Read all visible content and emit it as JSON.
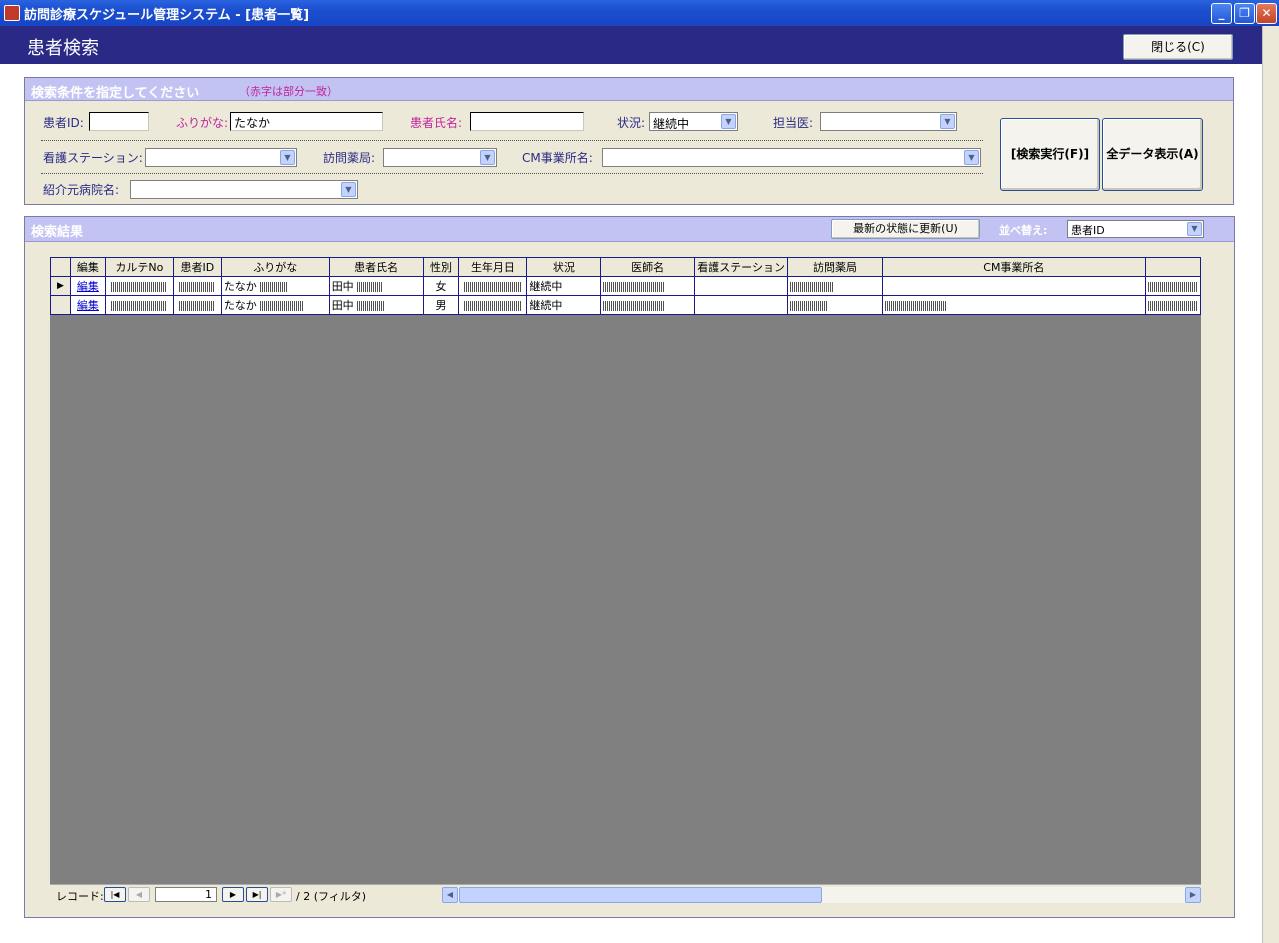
{
  "window": {
    "title": "訪問診療スケジュール管理システム - [患者一覧]",
    "minimize": "_",
    "restore": "❐",
    "close": "✕"
  },
  "header": {
    "title": "患者検索",
    "close_button": "閉じる(C)"
  },
  "search": {
    "section_title": "検索条件を指定してください",
    "hint": "（赤字は部分一致）",
    "patient_id_label": "患者ID:",
    "patient_id_value": "",
    "furigana_label": "ふりがな:",
    "furigana_value": "たなか",
    "name_label": "患者氏名:",
    "name_value": "",
    "status_label": "状況:",
    "status_value": "継続中",
    "doctor_label": "担当医:",
    "doctor_value": "",
    "nursing_label": "看護ステーション:",
    "nursing_value": "",
    "pharmacy_label": "訪問薬局:",
    "pharmacy_value": "",
    "cm_label": "CM事業所名:",
    "cm_value": "",
    "referral_label": "紹介元病院名:",
    "referral_value": "",
    "search_button": "[検索実行(F)]",
    "show_all_button": "全データ表示(A)"
  },
  "results": {
    "section_title": "検索結果",
    "refresh_button": "最新の状態に更新(U)",
    "sort_label": "並べ替え:",
    "sort_value": "患者ID",
    "columns": [
      "編集",
      "カルテNo",
      "患者ID",
      "ふりがな",
      "患者氏名",
      "性別",
      "生年月日",
      "状況",
      "医師名",
      "看護ステーション",
      "訪問薬局",
      "CM事業所名"
    ],
    "rows": [
      {
        "edit": "編集",
        "furigana": "たなか",
        "name": "田中",
        "sex": "女",
        "status": "継続中"
      },
      {
        "edit": "編集",
        "furigana": "たなか",
        "name": "田中",
        "sex": "男",
        "status": "継続中"
      }
    ]
  },
  "navigation": {
    "label": "レコード:",
    "current": "1",
    "of_text": "/ 2 (フィルタ)"
  },
  "colors": {
    "header_bg": "#2a2a86",
    "panel_head_bg": "#c3c3f3",
    "panel_bg": "#ece9d8",
    "accent_red": "#c0239b",
    "grid_empty_bg": "#808080"
  },
  "icons": {
    "combo_arrow": "▼",
    "nav_first": "|◀",
    "nav_prev": "◀",
    "nav_next": "▶",
    "nav_last": "▶|",
    "nav_new": "▶*",
    "record_selector": "▶",
    "scroll_left": "◀",
    "scroll_right": "▶"
  }
}
